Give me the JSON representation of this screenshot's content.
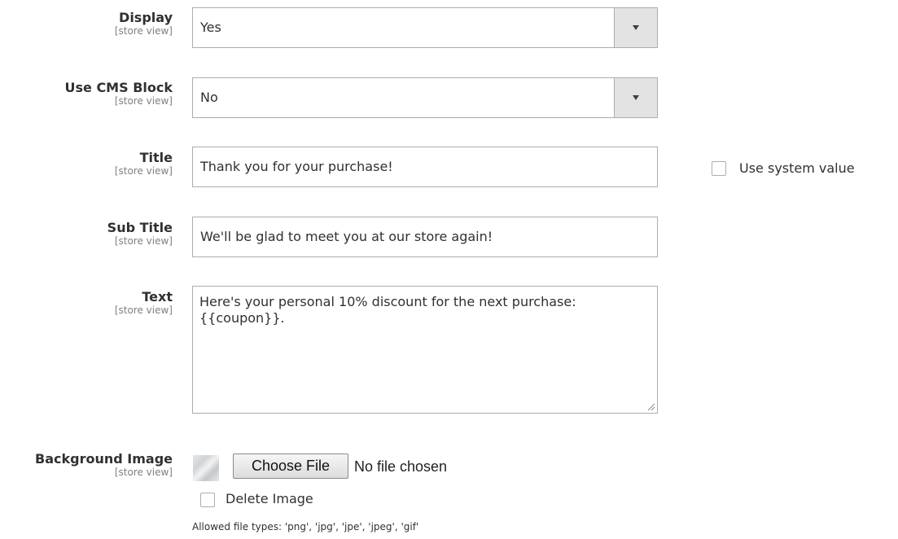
{
  "fields": {
    "display": {
      "label": "Display",
      "scope": "[store view]",
      "value": "Yes"
    },
    "use_cms_block": {
      "label": "Use CMS Block",
      "scope": "[store view]",
      "value": "No"
    },
    "title": {
      "label": "Title",
      "scope": "[store view]",
      "value": "Thank you for your purchase!",
      "use_system_value_label": "Use system value",
      "use_system_value_checked": false
    },
    "sub_title": {
      "label": "Sub Title",
      "scope": "[store view]",
      "value": "We'll be glad to meet you at our store again!"
    },
    "text": {
      "label": "Text",
      "scope": "[store view]",
      "value": "Here's your personal 10% discount for the next purchase: {{coupon}}."
    },
    "background_image": {
      "label": "Background Image",
      "scope": "[store view]",
      "choose_file_label": "Choose File",
      "no_file_text": "No file chosen",
      "delete_image_label": "Delete Image",
      "delete_image_checked": false,
      "allowed_types_note": "Allowed file types: 'png', 'jpg', 'jpe', 'jpeg', 'gif'"
    }
  },
  "icons": {
    "dropdown_arrow": "chevron-down-icon",
    "textarea_resize": "resize-grip-icon",
    "image_preview": "image-thumbnail-icon"
  },
  "colors": {
    "border": "#adadad",
    "select_button_bg": "#e3e3e3",
    "label_text": "#303030",
    "scope_text": "#808080"
  }
}
